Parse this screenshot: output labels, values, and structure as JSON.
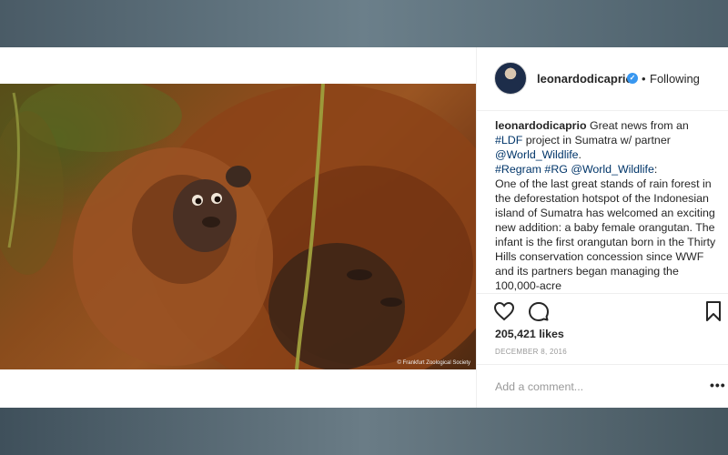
{
  "post": {
    "username": "leonardodicaprio",
    "verified": true,
    "separator": "•",
    "follow_state": "Following",
    "verified_glyph": "✓",
    "photo_credit": "© Frankfurt Zoological Society",
    "caption": {
      "username": "leonardodicaprio",
      "intro": " Great news from an ",
      "tag1": "#LDF",
      "mid1": " project in Sumatra w/ partner ",
      "mention1": "@World_Wildlife",
      "period": ".",
      "tag2": "#Regram",
      "space1": " ",
      "tag3": "#RG",
      "space2": " ",
      "mention2": "@World_Wildlife",
      "colon": ":",
      "body": "One of the last great stands of rain forest in the deforestation hotspot of the Indonesian island of Sumatra has welcomed an exciting new addition: a baby female orangutan. The infant is the first orangutan born in the Thirty Hills conservation concession since WWF and its partners began managing the 100,000-acre"
    },
    "likes": "205,421 likes",
    "date": "DECEMBER 8, 2016",
    "comment_placeholder": "Add a comment...",
    "more_label": "•••"
  },
  "icons": {
    "like": "heart-icon",
    "comment": "comment-icon",
    "save": "bookmark-icon",
    "verified": "verified-badge-icon"
  },
  "colors": {
    "link": "#003569",
    "verified": "#3897f0",
    "text": "#262626",
    "muted": "#999999"
  }
}
